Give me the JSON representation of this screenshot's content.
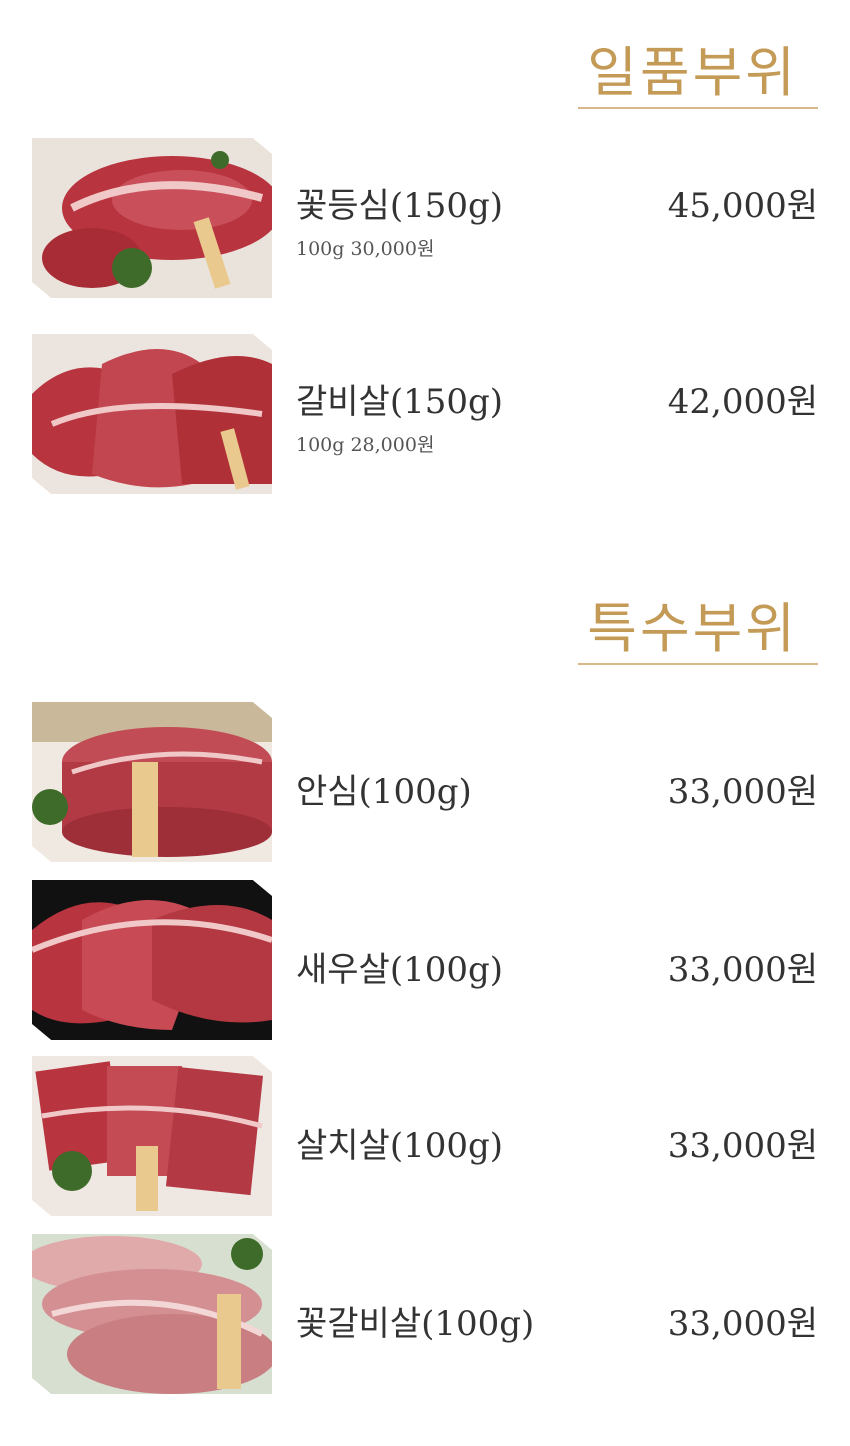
{
  "sections": [
    {
      "title": "일품부위",
      "items": [
        {
          "name": "꽃등심(150g)",
          "unit_price": "100g 30,000원",
          "price": "45,000원"
        },
        {
          "name": "갈비살(150g)",
          "unit_price": "100g 28,000원",
          "price": "42,000원"
        }
      ]
    },
    {
      "title": "특수부위",
      "items": [
        {
          "name": "안심(100g)",
          "price": "33,000원"
        },
        {
          "name": "새우살(100g)",
          "price": "33,000원"
        },
        {
          "name": "살치살(100g)",
          "price": "33,000원"
        },
        {
          "name": "꽃갈비살(100g)",
          "price": "33,000원"
        }
      ]
    }
  ],
  "colors": {
    "accent": "#c49a57",
    "rule": "#d8b889",
    "text": "#333333",
    "meat_red": "#b8343f",
    "marbling": "#f0c8c8"
  }
}
